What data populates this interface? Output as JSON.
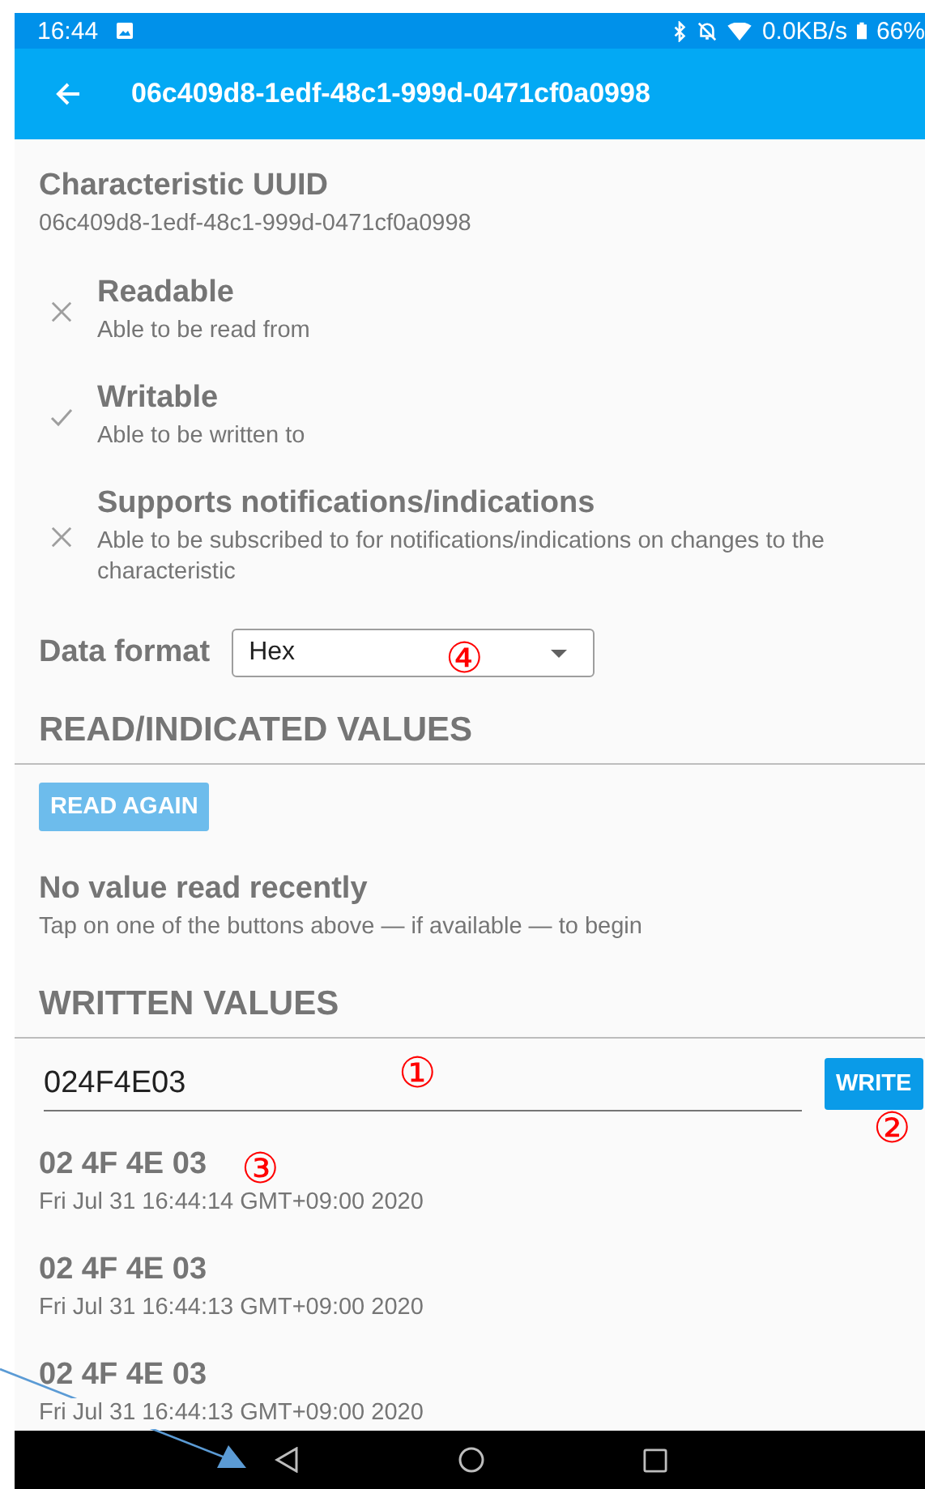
{
  "status_bar": {
    "time": "16:44",
    "net_speed": "0.0KB/s",
    "battery": "66%"
  },
  "app_bar": {
    "title": "06c409d8-1edf-48c1-999d-0471cf0a0998"
  },
  "characteristic": {
    "label": "Characteristic UUID",
    "uuid": "06c409d8-1edf-48c1-999d-0471cf0a0998"
  },
  "properties": [
    {
      "name": "Readable",
      "description": "Able to be read from",
      "supported": false
    },
    {
      "name": "Writable",
      "description": "Able to be written to",
      "supported": true
    },
    {
      "name": "Supports notifications/indications",
      "description": "Able to be subscribed to for notifications/indications on changes to the characteristic",
      "supported": false
    }
  ],
  "data_format": {
    "label": "Data format",
    "value": "Hex"
  },
  "read_section": {
    "heading": "READ/INDICATED VALUES",
    "button": {
      "label": "READ AGAIN",
      "disabled": true
    },
    "empty_title": "No value read recently",
    "empty_hint": "Tap on one of the buttons above — if available — to begin"
  },
  "write_section": {
    "heading": "WRITTEN VALUES",
    "input_value": "024F4E03",
    "button": {
      "label": "WRITE",
      "disabled": false
    },
    "entries": [
      {
        "value": "02 4F 4E 03",
        "time": "Fri Jul 31 16:44:14 GMT+09:00 2020"
      },
      {
        "value": "02 4F 4E 03",
        "time": "Fri Jul 31 16:44:13 GMT+09:00 2020"
      },
      {
        "value": "02 4F 4E 03",
        "time": "Fri Jul 31 16:44:13 GMT+09:00 2020"
      }
    ]
  },
  "annotations": [
    "①",
    "②",
    "③",
    "④"
  ]
}
